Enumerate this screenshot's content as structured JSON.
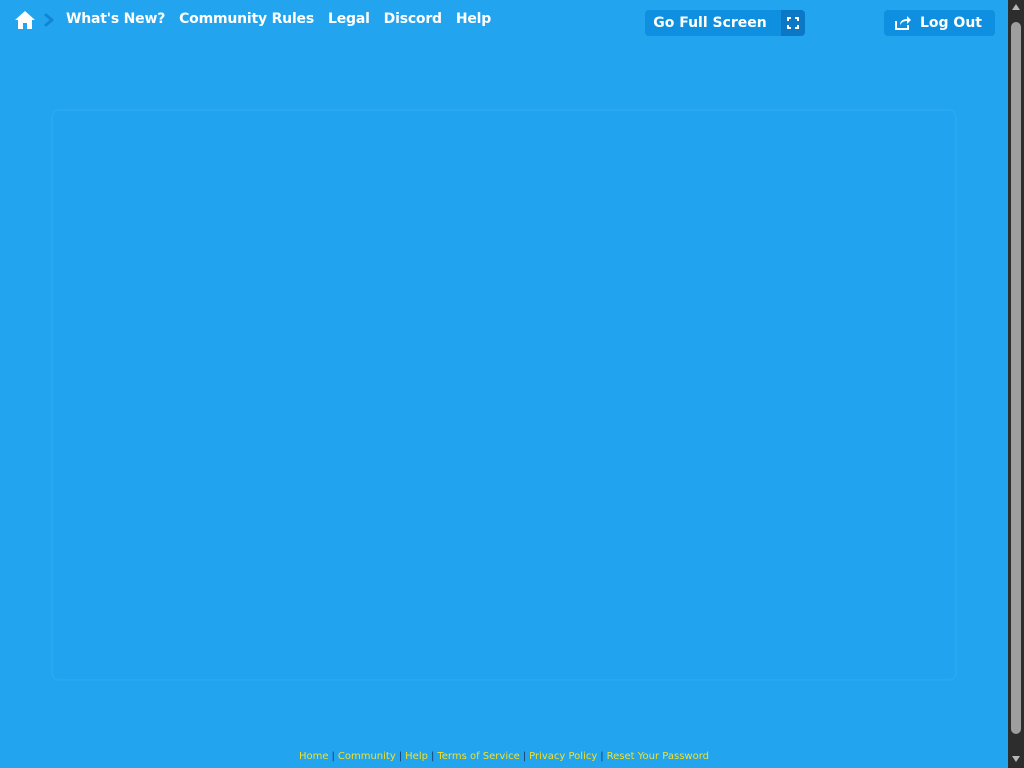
{
  "nav": {
    "links": [
      "What's New?",
      "Community Rules",
      "Legal",
      "Discord",
      "Help"
    ]
  },
  "toolbar": {
    "fullscreen_label": "Go Full Screen",
    "logout_label": "Log Out"
  },
  "footer": {
    "links": [
      "Home",
      "Community",
      "Help",
      "Terms of Service",
      "Privacy Policy",
      "Reset Your Password"
    ],
    "separator": "|"
  },
  "icons": {
    "home": "home-icon",
    "breadcrumb": "chevron-right-icon",
    "fullscreen": "expand-icon",
    "logout": "share-arrow-icon"
  },
  "colors": {
    "background": "#22a4ee",
    "button": "#0f8fe0",
    "footer_link": "#f5e024"
  }
}
